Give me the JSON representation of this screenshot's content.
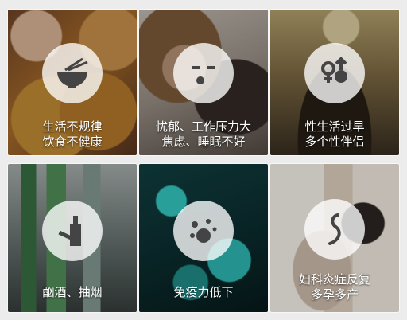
{
  "tiles": [
    {
      "lines": [
        "生活不规律",
        "饮食不健康"
      ],
      "icon": "bowl-chopsticks-icon"
    },
    {
      "lines": [
        "忧郁、工作压力大",
        "焦虑、睡眠不好"
      ],
      "icon": "sad-face-icon"
    },
    {
      "lines": [
        "性生活过早",
        "多个性伴侣"
      ],
      "icon": "gender-symbols-icon"
    },
    {
      "lines": [
        "酗酒、抽烟"
      ],
      "icon": "bottle-cigarette-icon"
    },
    {
      "lines": [
        "免疫力低下"
      ],
      "icon": "virus-cells-icon"
    },
    {
      "lines": [
        "妇科炎症反复",
        "多孕多产"
      ],
      "icon": "pregnancy-icon"
    }
  ],
  "colors": {
    "label_text": "#ffffff",
    "icon_circle_bg": "#ffffffc7",
    "icon_stroke": "#444444"
  }
}
